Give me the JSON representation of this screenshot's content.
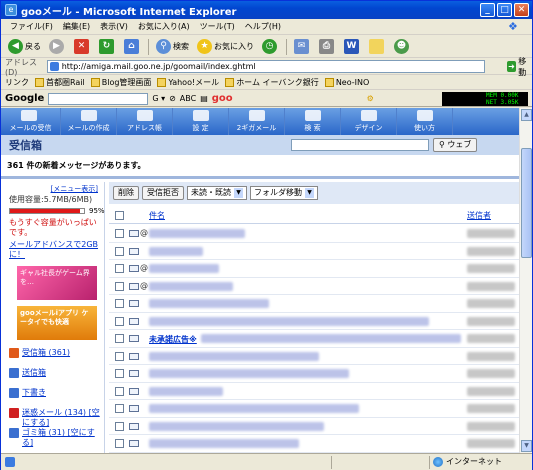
{
  "window": {
    "title": "gooメール - Microsoft Internet Explorer",
    "app_icon_letter": "e",
    "controls": [
      "_",
      "□",
      "✕"
    ]
  },
  "menubar": [
    "ファイル(F)",
    "編集(E)",
    "表示(V)",
    "お気に入り(A)",
    "ツール(T)",
    "ヘルプ(H)"
  ],
  "toolbar": {
    "back": "戻る",
    "search": "検索",
    "favorites": "お気に入り"
  },
  "address": {
    "label": "アドレス(D)",
    "url": "http://amiga.mail.goo.ne.jp/goomail/index.ghtml",
    "go": "移動"
  },
  "links": {
    "label": "リンク",
    "items": [
      "首都圏Rail",
      "Blog管理画面",
      "Yahoo!メール",
      "ホーム イーバンク銀行",
      "Neo-INO"
    ]
  },
  "googlebar": {
    "logo": "Google",
    "goo": "goo",
    "meter_lines": [
      "MEM 0.00K",
      "NET 3.05K"
    ]
  },
  "nav": [
    "メールの受信",
    "メールの作成",
    "アドレス帳",
    "設 定",
    "2ギガメール",
    "検 索",
    "デザイン",
    "使い方"
  ],
  "nav_icons": [
    "inbox-icon",
    "compose-icon",
    "addressbook-icon",
    "settings-icon",
    "calendar-icon",
    "search-icon",
    "design-icon",
    "help-icon"
  ],
  "inbox": {
    "title": "受信箱",
    "web_search_button": "ウェブ",
    "new_message_notice": "361 件の新着メッセージがあります。"
  },
  "sidebar": {
    "menu_link": "[メニュー表示]",
    "capacity": "使用容量:5.7MB/6MB)",
    "usage_percent": 95,
    "usage_label": "95%",
    "warning": "もうすぐ容量がいっぱいです。",
    "upgrade_link": "メールアドバンスで2GBに！",
    "banner1_text": "ギャル社長がゲーム界を…",
    "banner2_text": "gooメールiアプリ ケータイでも快適",
    "folders": [
      {
        "label": "受信箱 (361)",
        "color": "#e05a1a"
      },
      {
        "label": "送信箱",
        "color": "#3a6fd0"
      },
      {
        "label": "下書き",
        "color": "#3a6fd0"
      },
      {
        "label": "迷惑メール (134) [空にする]",
        "color": "#d02020"
      },
      {
        "label": "ゴミ箱 (31) [空にする]",
        "color": "#3a6fd0"
      }
    ]
  },
  "actions": {
    "delete": "削除",
    "spam": "受信拒否",
    "unread_select": "未読・既読",
    "folder_move": "フォルダ移動"
  },
  "list_header": {
    "subject": "件名",
    "from": "送信者"
  },
  "messages": [
    {
      "clip": "@",
      "subject": ""
    },
    {
      "clip": "",
      "subject": ""
    },
    {
      "clip": "@",
      "subject": ""
    },
    {
      "clip": "@",
      "subject": ""
    },
    {
      "clip": "",
      "subject": ""
    },
    {
      "clip": "",
      "subject": ""
    },
    {
      "clip": "",
      "subject": "未承諾広告※"
    },
    {
      "clip": "",
      "subject": ""
    },
    {
      "clip": "",
      "subject": ""
    },
    {
      "clip": "",
      "subject": ""
    },
    {
      "clip": "",
      "subject": ""
    },
    {
      "clip": "",
      "subject": ""
    },
    {
      "clip": "",
      "subject": ""
    }
  ],
  "status": {
    "zone": "インターネット"
  },
  "colors": {
    "title_blue": "#0146d0",
    "nav_blue": "#2a67c9",
    "warn_red": "#d01010",
    "link_blue": "#0033cc"
  }
}
